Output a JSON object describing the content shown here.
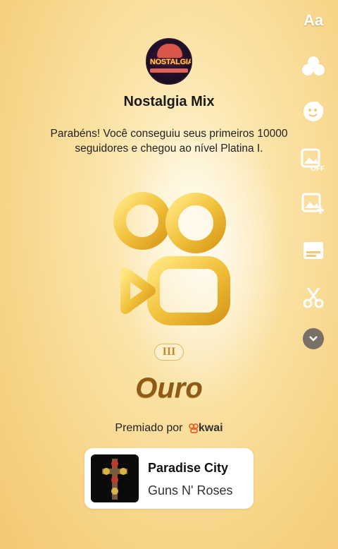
{
  "profile": {
    "channel_name": "Nostalgia Mix",
    "avatar_logo_text": "NOSTALGIA"
  },
  "message": "Parabéns! Você conseguiu seus primeiros 10000 seguidores e chegou ao nível Platina I.",
  "badge": {
    "icon": "kwai-camera-icon",
    "tier": "III",
    "level": "Ouro"
  },
  "awarded": {
    "label": "Premiado por",
    "brand": "kwai"
  },
  "music": {
    "title": "Paradise City",
    "artist": "Guns N' Roses"
  },
  "toolbar": {
    "text_tool": "Aa",
    "effects_icon": "effects-icon",
    "sticker_icon": "sticker-icon",
    "image_off_icon": "image-off-icon",
    "add_image_icon": "add-image-icon",
    "caption_icon": "caption-icon",
    "cut_icon": "scissors-icon",
    "more_icon": "chevron-down-icon"
  },
  "colors": {
    "background": "#f7d487",
    "level_text": "#8d5a17",
    "badge_gold": "#f2c23c"
  }
}
